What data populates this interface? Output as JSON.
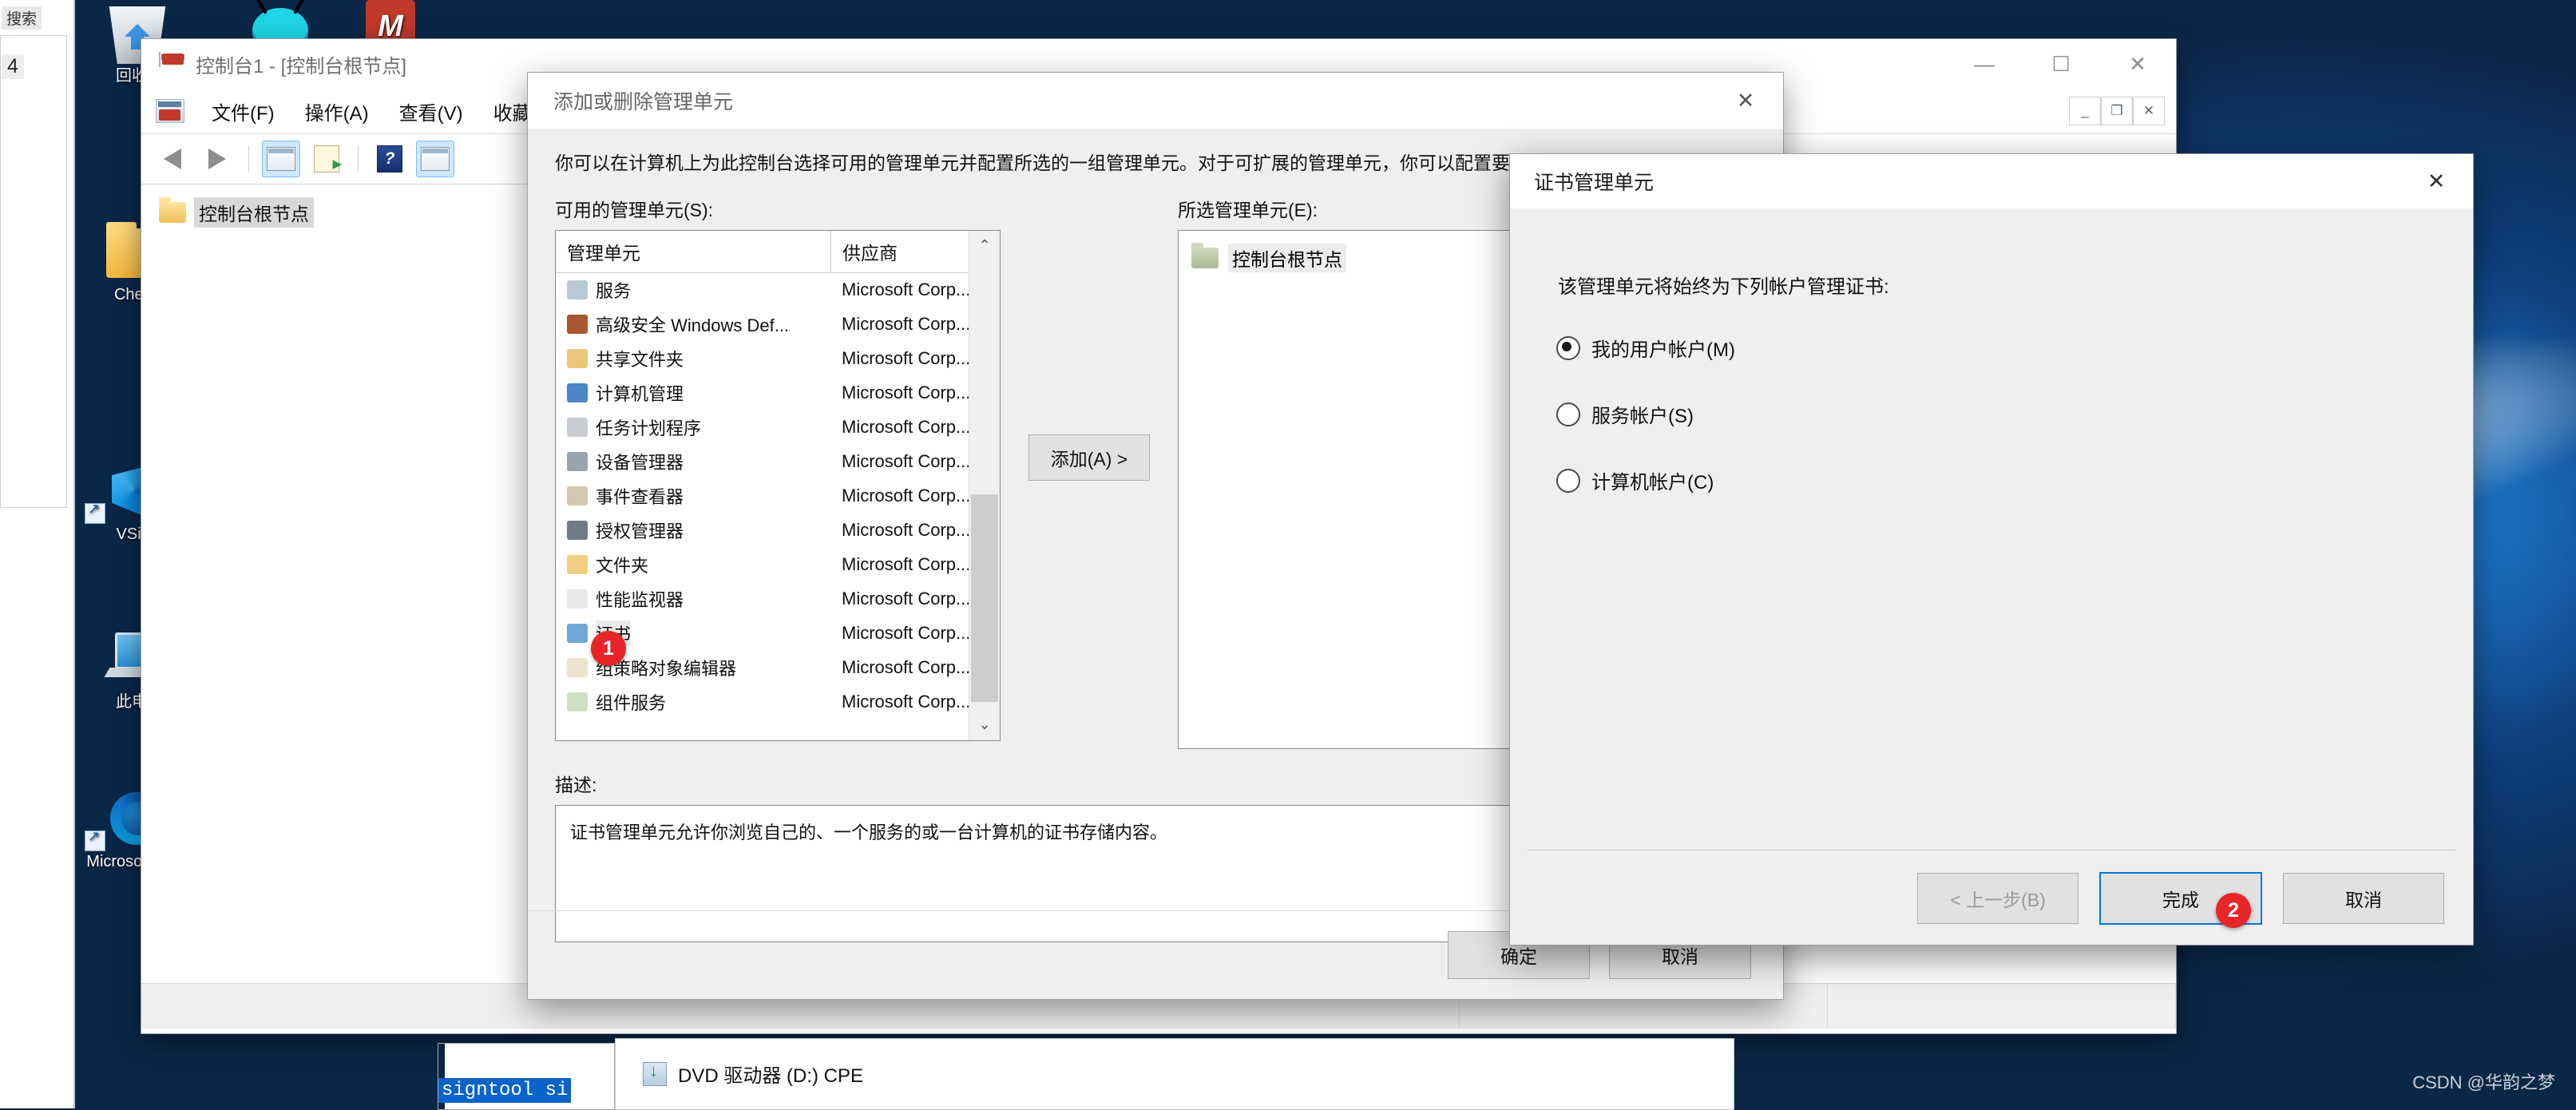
{
  "desktop": {
    "icons": [
      {
        "name": "recycle-bin",
        "label": "回收站"
      },
      {
        "name": "bug-app",
        "label": ""
      },
      {
        "name": "cheat-folder",
        "label": "Cheat..."
      },
      {
        "name": "word-doc",
        "label": "M"
      },
      {
        "name": "vsign-shortcut",
        "label": "VSig..."
      },
      {
        "name": "this-pc",
        "label": "此电脑"
      },
      {
        "name": "edge-shortcut",
        "label": "Microsoft Edge"
      }
    ],
    "watermark": "CSDN @华韵之梦",
    "left_panel": {
      "label": "搜索",
      "number": "4"
    }
  },
  "mmc": {
    "title": "控制台1 - [控制台根节点]",
    "menu": [
      "文件(F)",
      "操作(A)",
      "查看(V)",
      "收藏夹(O)"
    ],
    "window_controls": {
      "minimize": "—",
      "maximize": "☐",
      "close": "✕"
    },
    "mdi_controls": {
      "minimize": "_",
      "restore": "❐",
      "close": "✕"
    },
    "toolbar": [
      {
        "name": "back-icon",
        "label": "←"
      },
      {
        "name": "forward-icon",
        "label": "→"
      },
      {
        "name": "show-hide-tree-icon",
        "label": ""
      },
      {
        "name": "export-list-icon",
        "label": ""
      },
      {
        "name": "help-icon",
        "label": "?"
      },
      {
        "name": "show-action-pane-icon",
        "label": ""
      }
    ],
    "tree": [
      {
        "label": "控制台根节点"
      }
    ]
  },
  "add_dialog": {
    "title": "添加或删除管理单元",
    "close": "✕",
    "intro": "你可以在计算机上为此控制台选择可用的管理单元并配置所选的一组管理单元。对于可扩展的管理单元，你可以配置要启用哪些扩展项。",
    "available_label": "可用的管理单元(S):",
    "columns": [
      "管理单元",
      "供应商"
    ],
    "rows": [
      {
        "name": "服务",
        "vendor": "Microsoft Corp...",
        "color": "#b9c9d8"
      },
      {
        "name": "高级安全 Windows Def...",
        "vendor": "Microsoft Corp...",
        "color": "#a8562f"
      },
      {
        "name": "共享文件夹",
        "vendor": "Microsoft Corp...",
        "color": "#e9c877"
      },
      {
        "name": "计算机管理",
        "vendor": "Microsoft Corp...",
        "color": "#4a86c8"
      },
      {
        "name": "任务计划程序",
        "vendor": "Microsoft Corp...",
        "color": "#c9cdd2"
      },
      {
        "name": "设备管理器",
        "vendor": "Microsoft Corp...",
        "color": "#9aa4ae"
      },
      {
        "name": "事件查看器",
        "vendor": "Microsoft Corp...",
        "color": "#d6c8b0"
      },
      {
        "name": "授权管理器",
        "vendor": "Microsoft Corp...",
        "color": "#6f7a86"
      },
      {
        "name": "文件夹",
        "vendor": "Microsoft Corp...",
        "color": "#f2cf7e"
      },
      {
        "name": "性能监视器",
        "vendor": "Microsoft Corp...",
        "color": "#e8e8e8"
      },
      {
        "name": "证书",
        "vendor": "Microsoft Corp...",
        "color": "#6fa8d6"
      },
      {
        "name": "组策略对象编辑器",
        "vendor": "Microsoft Corp...",
        "color": "#ebe3cf"
      },
      {
        "name": "组件服务",
        "vendor": "Microsoft Corp...",
        "color": "#cfe0c3"
      }
    ],
    "add_button": "添加(A) >",
    "selected_label": "所选管理单元(E):",
    "selected_items": [
      "控制台根节点"
    ],
    "description_label": "描述:",
    "description_text": "证书管理单元允许你浏览自己的、一个服务的或一台计算机的证书存储内容。",
    "ok_button": "确定",
    "cancel_button": "取消",
    "scroll_up": "⌃",
    "scroll_down": "⌄"
  },
  "cert_dialog": {
    "title": "证书管理单元",
    "close": "✕",
    "prompt": "该管理单元将始终为下列帐户管理证书:",
    "options": [
      {
        "label": "我的用户帐户(M)",
        "selected": true
      },
      {
        "label": "服务帐户(S)",
        "selected": false
      },
      {
        "label": "计算机帐户(C)",
        "selected": false
      }
    ],
    "back_button": "< 上一步(B)",
    "finish_button": "完成",
    "cancel_button": "取消"
  },
  "step_badges": [
    {
      "id": "1",
      "target": "证书"
    },
    {
      "id": "2",
      "target": "完成"
    }
  ],
  "bottom_windows": {
    "console_command": "signtool si",
    "dvd_label": "DVD 驱动器 (D:) CPE"
  },
  "colors": {
    "accent": "#0078d7",
    "badge": "#e8262a",
    "dialog_bg": "#efefef",
    "desktop": "#0d2444"
  }
}
